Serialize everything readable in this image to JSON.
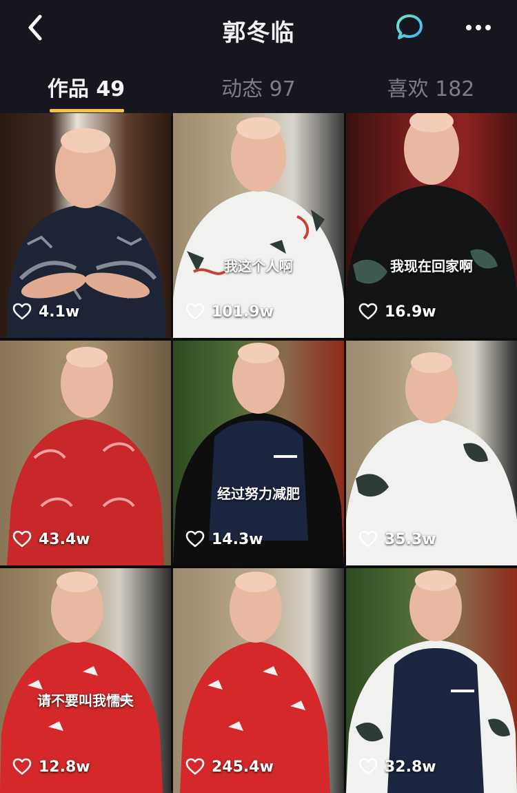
{
  "header": {
    "title": "郭冬临"
  },
  "tabs": [
    {
      "label": "作品 49"
    },
    {
      "label": "动态 97"
    },
    {
      "label": "喜欢 182"
    }
  ],
  "icons": {
    "back": "chevron-left-icon",
    "chat": "chat-bubble-icon",
    "more": "more-dots-icon",
    "like": "heart-icon"
  },
  "colors": {
    "background": "#16161e",
    "tab_active": "#f5f5f5",
    "tab_inactive": "#7d7d83",
    "tab_indicator": "#f4c545",
    "chat_icon_gradient_start": "#6fe7c8",
    "chat_icon_gradient_end": "#3fb4f5"
  },
  "videos": [
    {
      "likes": "4.1w",
      "caption": ""
    },
    {
      "likes": "101.9w",
      "caption": "我这个人啊"
    },
    {
      "likes": "16.9w",
      "caption": "我现在回家啊"
    },
    {
      "likes": "43.4w",
      "caption": ""
    },
    {
      "likes": "14.3w",
      "caption": "经过努力减肥"
    },
    {
      "likes": "35.3w",
      "caption": ""
    },
    {
      "likes": "12.8w",
      "caption": "请不要叫我懦夫"
    },
    {
      "likes": "245.4w",
      "caption": ""
    },
    {
      "likes": "32.8w",
      "caption": ""
    }
  ]
}
